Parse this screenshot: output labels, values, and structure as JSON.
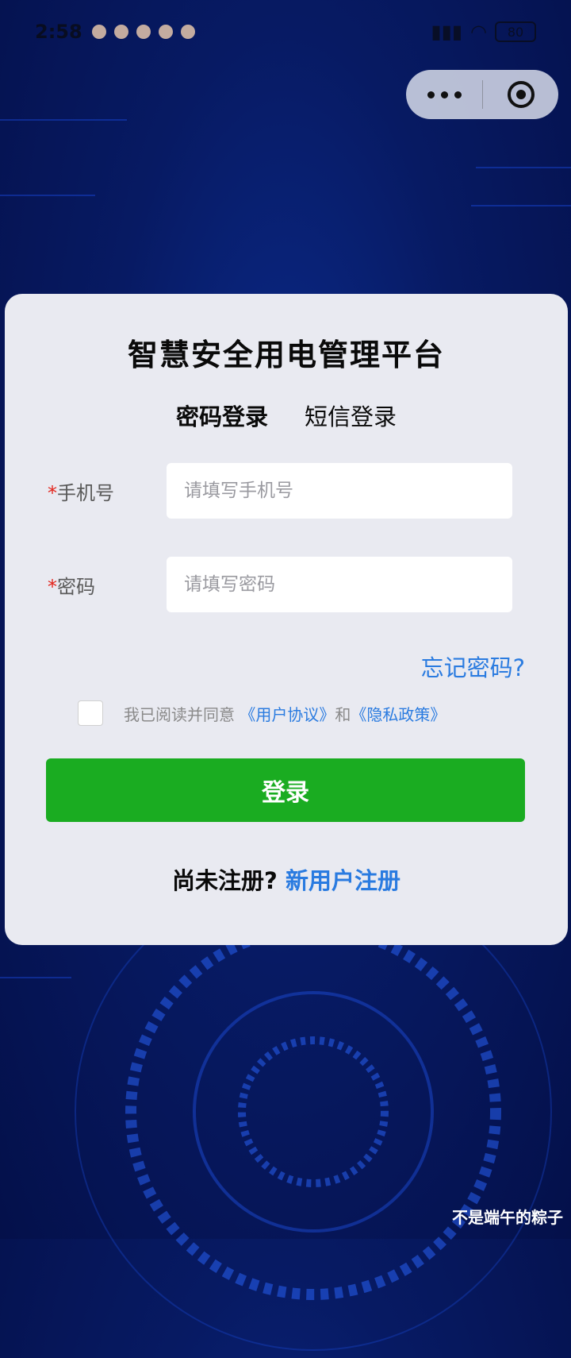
{
  "status_bar": {
    "time": "2:58",
    "battery": "80"
  },
  "capsule": {
    "more_icon": "more-dots-icon",
    "target_icon": "record-target-icon"
  },
  "card": {
    "title": "智慧安全用电管理平台",
    "tabs": [
      {
        "label": "密码登录",
        "active": true
      },
      {
        "label": "短信登录",
        "active": false
      }
    ],
    "phone": {
      "required_mark": "*",
      "label": "手机号",
      "placeholder": "请填写手机号",
      "value": ""
    },
    "password": {
      "required_mark": "*",
      "label": "密码",
      "placeholder": "请填写密码",
      "value": ""
    },
    "forgot_label": "忘记密码?",
    "agreement": {
      "checked": false,
      "prefix": "我已阅读并同意",
      "user_agreement": "《用户协议》",
      "and": "和",
      "privacy_policy": "《隐私政策》"
    },
    "login_label": "登录",
    "register": {
      "prompt": "尚未注册?",
      "link": "新用户注册"
    }
  },
  "watermark": "不是端午的粽子",
  "colors": {
    "accent": "#2a7be0",
    "login_button": "#1aac21",
    "required": "#e3241b",
    "card": "#e9eaf1",
    "background": "#071a63"
  }
}
